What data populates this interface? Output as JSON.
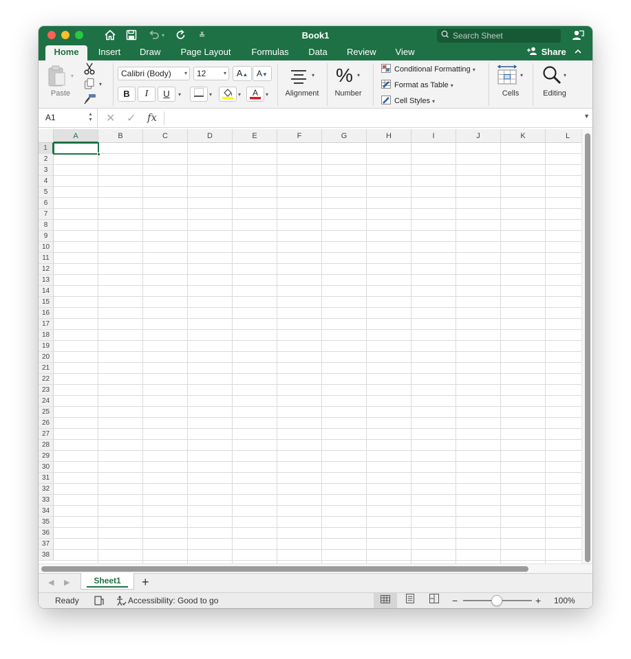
{
  "window": {
    "title": "Book1",
    "search_placeholder": "Search Sheet"
  },
  "tabs": [
    "Home",
    "Insert",
    "Draw",
    "Page Layout",
    "Formulas",
    "Data",
    "Review",
    "View"
  ],
  "active_tab": "Home",
  "share_label": "Share",
  "ribbon": {
    "paste_label": "Paste",
    "font_name": "Calibri (Body)",
    "font_size": "12",
    "bold": "B",
    "italic": "I",
    "underline": "U",
    "alignment_label": "Alignment",
    "number_label": "Number",
    "number_symbol": "%",
    "conditional_formatting": "Conditional Formatting",
    "format_as_table": "Format as Table",
    "cell_styles": "Cell Styles",
    "cells_label": "Cells",
    "editing_label": "Editing",
    "font_color": "#e81123",
    "fill_color": "#ffff00"
  },
  "formula_bar": {
    "name_box": "A1",
    "fx": "fx",
    "formula": ""
  },
  "grid": {
    "columns": [
      "A",
      "B",
      "C",
      "D",
      "E",
      "F",
      "G",
      "H",
      "I",
      "J",
      "K",
      "L"
    ],
    "rows": [
      "1",
      "2",
      "3",
      "4",
      "5",
      "6",
      "7",
      "8",
      "9",
      "10",
      "11",
      "12",
      "13",
      "14",
      "15",
      "16",
      "17",
      "18",
      "19",
      "20",
      "21",
      "22",
      "23",
      "24",
      "25",
      "26",
      "27",
      "28",
      "29",
      "30",
      "31",
      "32",
      "33",
      "34",
      "35",
      "36",
      "37",
      "38"
    ],
    "active_cell": "A1"
  },
  "sheets": [
    "Sheet1"
  ],
  "status": {
    "ready": "Ready",
    "accessibility": "Accessibility: Good to go",
    "zoom": "100%"
  },
  "colors": {
    "accent": "#1e7145",
    "ribbon_bg": "#f3f3f3"
  }
}
